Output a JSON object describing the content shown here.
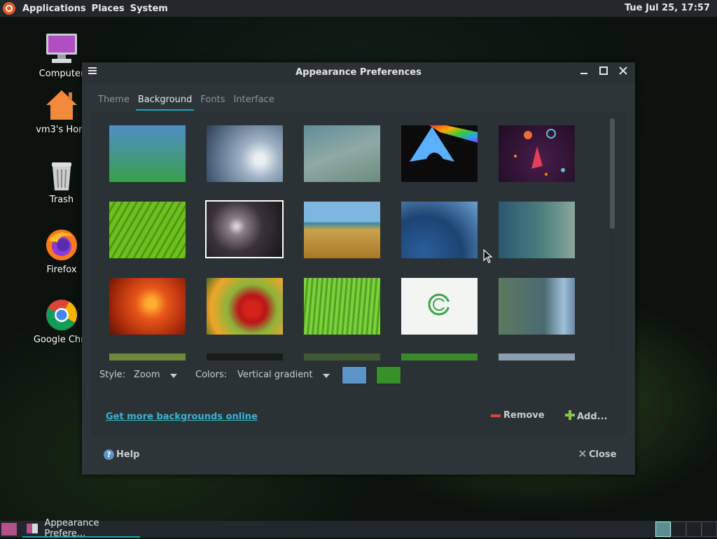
{
  "top_panel": {
    "menus": [
      "Applications",
      "Places",
      "System"
    ],
    "clock": "Tue Jul 25, 17:57"
  },
  "desktop": {
    "icons": [
      {
        "label": "Computer",
        "icon": "computer-icon"
      },
      {
        "label": "vm3's Hom",
        "icon": "home-folder-icon"
      },
      {
        "label": "Trash",
        "icon": "trash-icon"
      },
      {
        "label": "Firefox",
        "icon": "firefox-icon"
      },
      {
        "label": "Google Chro",
        "icon": "chrome-icon"
      }
    ]
  },
  "window": {
    "title": "Appearance Preferences",
    "tabs": [
      {
        "label": "Theme",
        "active": false
      },
      {
        "label": "Background",
        "active": true
      },
      {
        "label": "Fonts",
        "active": false
      },
      {
        "label": "Interface",
        "active": false
      }
    ],
    "style_label": "Style:",
    "style_value": "Zoom",
    "colors_label": "Colors:",
    "colors_value": "Vertical gradient",
    "primary_color": "#5b95c8",
    "secondary_color": "#37902a",
    "link_text": "Get more backgrounds online",
    "remove_label": "Remove",
    "add_label": "Add...",
    "help_label": "Help",
    "close_label": "Close",
    "selected_thumbnail_index": 6
  },
  "taskbar": {
    "task_label": "Appearance Prefere..."
  }
}
